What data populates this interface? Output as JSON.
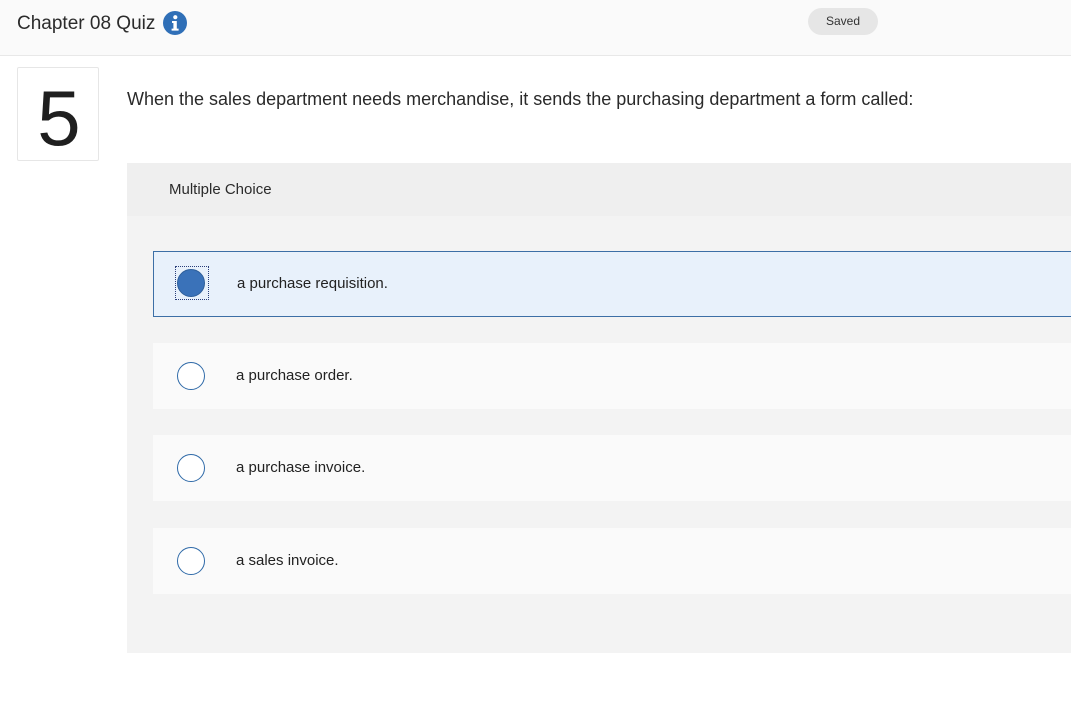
{
  "header": {
    "quiz_title": "Chapter 08 Quiz",
    "info_icon": "info-icon",
    "saved_label": "Saved"
  },
  "question": {
    "number": "5",
    "text": "When the sales department needs merchandise, it sends the purchasing department a form called:"
  },
  "answers": {
    "type_label": "Multiple Choice",
    "options": [
      {
        "label": "a purchase requisition.",
        "selected": true
      },
      {
        "label": "a purchase order.",
        "selected": false
      },
      {
        "label": "a purchase invoice.",
        "selected": false
      },
      {
        "label": "a sales invoice.",
        "selected": false
      }
    ]
  },
  "colors": {
    "accent": "#3a72b9",
    "selected_bg": "#e8f1fb"
  }
}
